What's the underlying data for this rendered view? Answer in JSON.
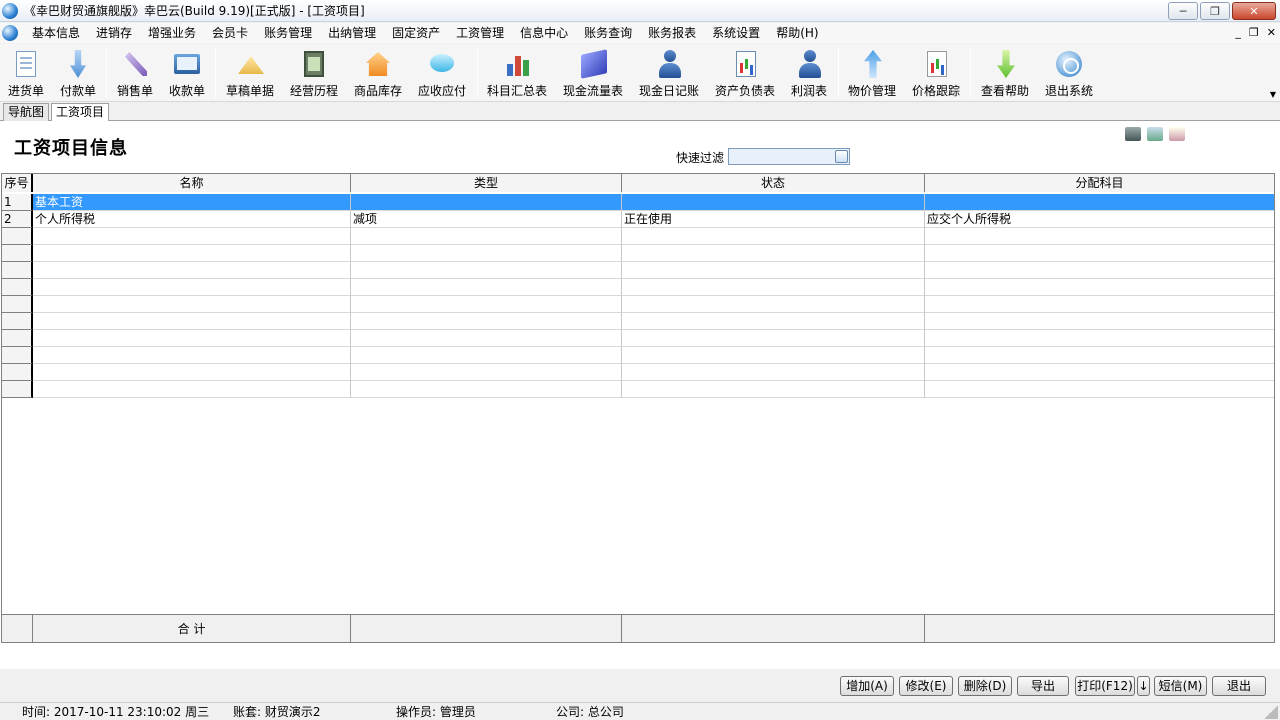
{
  "window": {
    "title": "《幸巴财贸通旗舰版》幸巴云(Build 9.19)[正式版] - [工资项目]",
    "minimize": "─",
    "maximize": "❐",
    "close": "✕"
  },
  "menu": {
    "items": [
      "基本信息",
      "进销存",
      "增强业务",
      "会员卡",
      "账务管理",
      "出纳管理",
      "固定资产",
      "工资管理",
      "信息中心",
      "账务查询",
      "账务报表",
      "系统设置",
      "帮助(H)"
    ],
    "mdi_min": "_",
    "mdi_restore": "❐",
    "mdi_close": "✕"
  },
  "toolbar": {
    "buttons": [
      {
        "label": "进货单",
        "icon": "purchase-doc-icon"
      },
      {
        "label": "付款单",
        "icon": "payment-arrow-icon"
      },
      {
        "label": "销售单",
        "icon": "sales-pen-icon"
      },
      {
        "label": "收款单",
        "icon": "receipt-book-icon"
      },
      {
        "label": "草稿单据",
        "icon": "draft-ruler-icon"
      },
      {
        "label": "经营历程",
        "icon": "history-film-icon"
      },
      {
        "label": "商品库存",
        "icon": "inventory-house-icon"
      },
      {
        "label": "应收应付",
        "icon": "receivable-bubble-icon"
      },
      {
        "label": "科目汇总表",
        "icon": "account-summary-chart-icon"
      },
      {
        "label": "现金流量表",
        "icon": "cashflow-disk-icon"
      },
      {
        "label": "现金日记账",
        "icon": "cash-journal-person-icon"
      },
      {
        "label": "资产负债表",
        "icon": "balance-sheet-icon"
      },
      {
        "label": "利润表",
        "icon": "profit-person-icon"
      },
      {
        "label": "物价管理",
        "icon": "price-upload-icon"
      },
      {
        "label": "价格跟踪",
        "icon": "price-tracking-icon"
      },
      {
        "label": "查看帮助",
        "icon": "help-download-icon"
      },
      {
        "label": "退出系统",
        "icon": "exit-system-icon"
      }
    ]
  },
  "tabs": [
    {
      "label": "导航图",
      "active": false
    },
    {
      "label": "工资项目",
      "active": true
    }
  ],
  "page": {
    "title": "工资项目信息",
    "filter_label": "快速过滤",
    "filter_value": ""
  },
  "grid": {
    "columns": [
      "序号",
      "名称",
      "类型",
      "状态",
      "分配科目"
    ],
    "rows": [
      {
        "index": "1",
        "name": "基本工资",
        "type": "",
        "status": "",
        "account": "",
        "selected": true
      },
      {
        "index": "2",
        "name": "个人所得税",
        "type": "减项",
        "status": "正在使用",
        "account": "应交个人所得税",
        "selected": false
      },
      {
        "index": "",
        "name": "",
        "type": "",
        "status": "",
        "account": ""
      },
      {
        "index": "",
        "name": "",
        "type": "",
        "status": "",
        "account": ""
      },
      {
        "index": "",
        "name": "",
        "type": "",
        "status": "",
        "account": ""
      },
      {
        "index": "",
        "name": "",
        "type": "",
        "status": "",
        "account": ""
      },
      {
        "index": "",
        "name": "",
        "type": "",
        "status": "",
        "account": ""
      },
      {
        "index": "",
        "name": "",
        "type": "",
        "status": "",
        "account": ""
      },
      {
        "index": "",
        "name": "",
        "type": "",
        "status": "",
        "account": ""
      },
      {
        "index": "",
        "name": "",
        "type": "",
        "status": "",
        "account": ""
      },
      {
        "index": "",
        "name": "",
        "type": "",
        "status": "",
        "account": ""
      },
      {
        "index": "",
        "name": "",
        "type": "",
        "status": "",
        "account": ""
      }
    ],
    "footer_label": "合  计"
  },
  "actions": {
    "add": "增加(A)",
    "edit": "修改(E)",
    "delete": "删除(D)",
    "export": "导出",
    "print": "打印(F12)",
    "print_more": "↓",
    "sms": "短信(M)",
    "exit": "退出"
  },
  "status": {
    "time": "时间: 2017-10-11 23:10:02 周三",
    "book": "账套: 财贸演示2",
    "operator": "操作员: 管理员",
    "company": "公司: 总公司"
  }
}
